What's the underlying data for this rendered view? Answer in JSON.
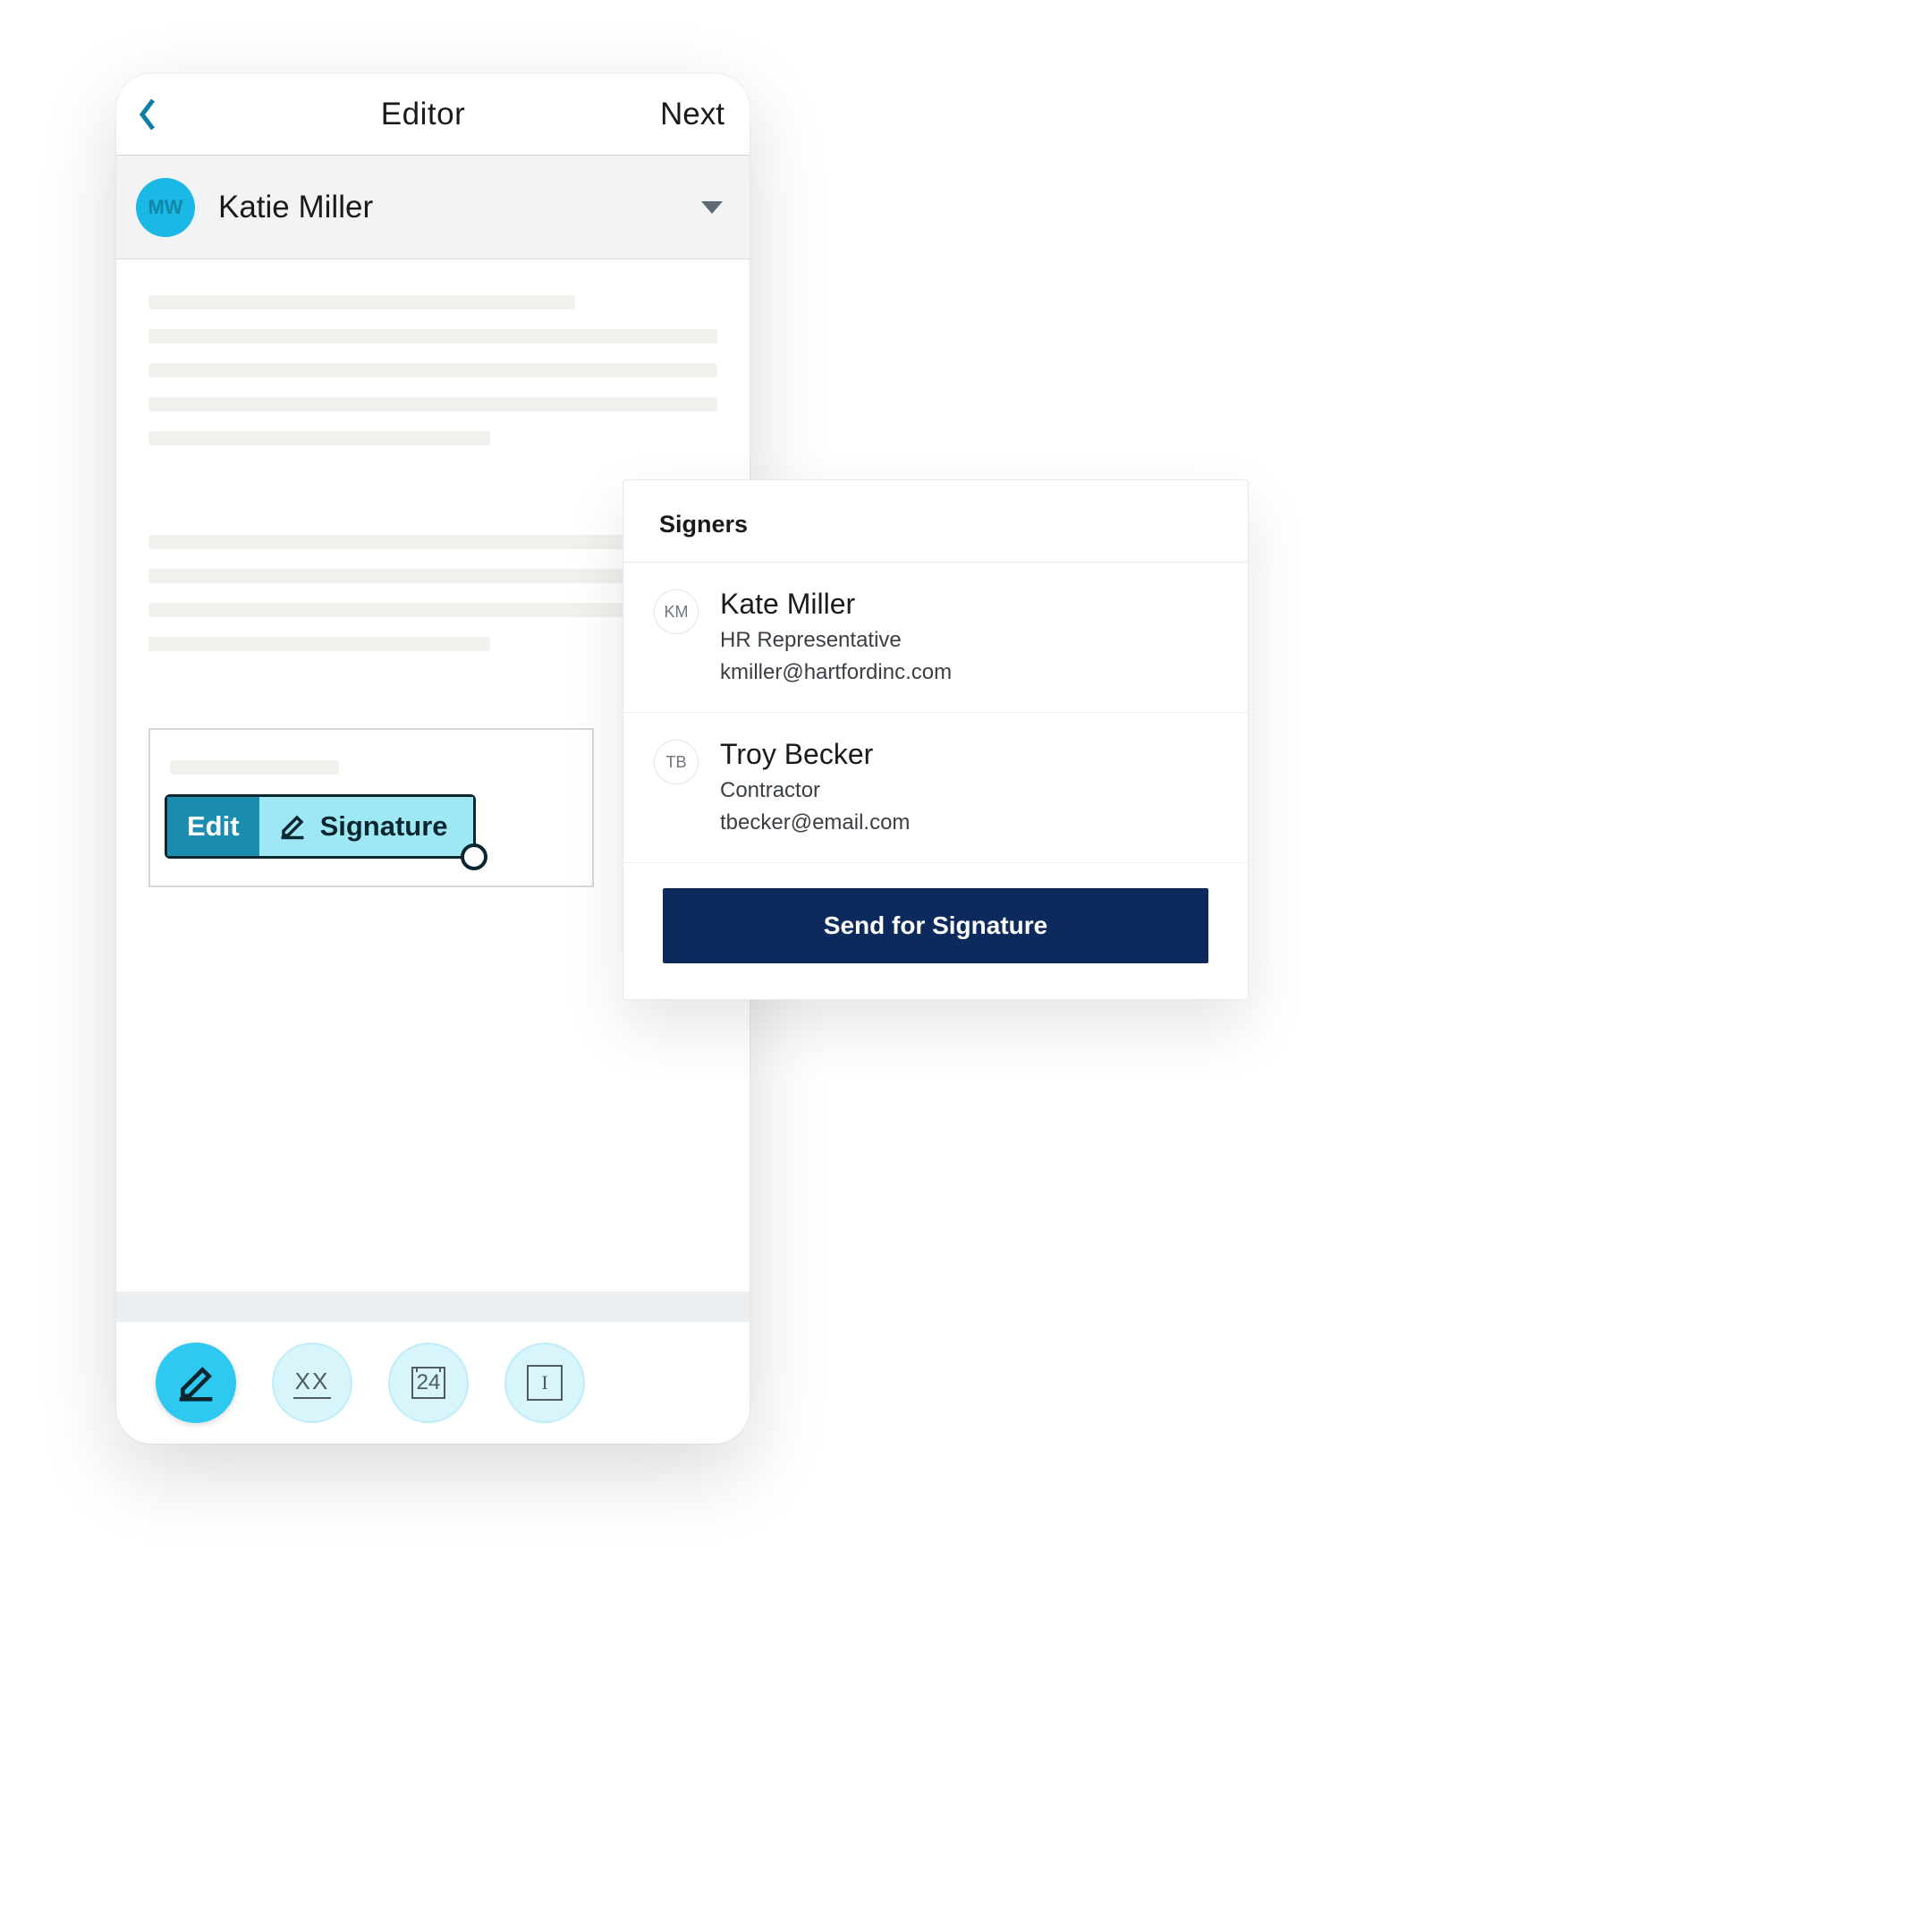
{
  "header": {
    "title": "Editor",
    "next_label": "Next"
  },
  "selector": {
    "avatar_initials": "MW",
    "name": "Katie Miller"
  },
  "field_chip": {
    "edit_label": "Edit",
    "signature_label": "Signature"
  },
  "toolbar": {
    "initials_placeholder": "XX",
    "date_placeholder": "24",
    "text_placeholder": "I"
  },
  "signers_panel": {
    "title": "Signers",
    "send_label": "Send for Signature",
    "signers": [
      {
        "initials": "KM",
        "name": "Kate Miller",
        "role": "HR Representative",
        "email": "kmiller@hartfordinc.com"
      },
      {
        "initials": "TB",
        "name": "Troy Becker",
        "role": "Contractor",
        "email": "tbecker@email.com"
      }
    ]
  }
}
